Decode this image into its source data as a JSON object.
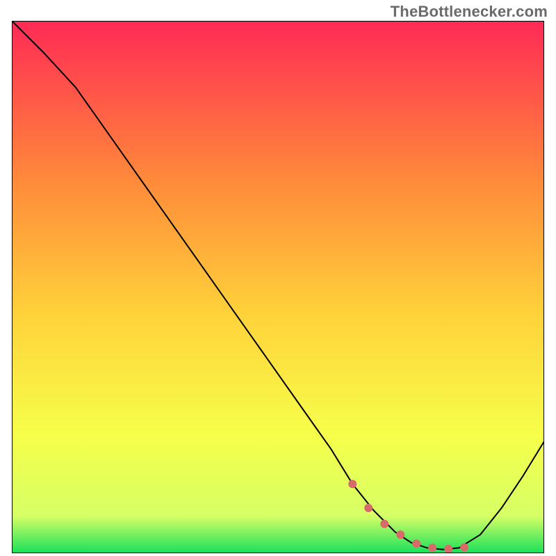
{
  "watermark": {
    "text": "TheBottlenecker.com"
  },
  "colors": {
    "grad_top": "#ff2a55",
    "grad_upper_mid": "#ff8a3a",
    "grad_mid": "#ffd23a",
    "grad_lower_mid": "#f6ff4a",
    "grad_near_bottom": "#d6ff66",
    "grad_bottom": "#18e05a",
    "curve": "#000000",
    "curve_marker": "#d96a6a",
    "frame": "#000000"
  },
  "chart_data": {
    "type": "line",
    "title": "",
    "xlabel": "",
    "ylabel": "",
    "xlim": [
      0,
      100
    ],
    "ylim": [
      0,
      100
    ],
    "grid": false,
    "legend": false,
    "series": [
      {
        "name": "bottleneck-curve",
        "x": [
          0,
          6,
          12,
          18,
          24,
          30,
          36,
          42,
          48,
          54,
          60,
          64,
          68,
          72,
          75,
          78,
          81,
          84,
          88,
          92,
          96,
          100
        ],
        "y": [
          100,
          94,
          87.5,
          79,
          70.5,
          62,
          53.5,
          45,
          36.5,
          28,
          19.5,
          13,
          8,
          4,
          2,
          1,
          0.7,
          1,
          3.5,
          8.5,
          14.5,
          21
        ]
      },
      {
        "name": "highlight-band",
        "x": [
          64,
          67,
          70,
          73,
          76,
          79,
          82,
          85
        ],
        "y": [
          13,
          8.5,
          5.5,
          3.5,
          1.8,
          1,
          0.8,
          1.1
        ]
      }
    ]
  }
}
